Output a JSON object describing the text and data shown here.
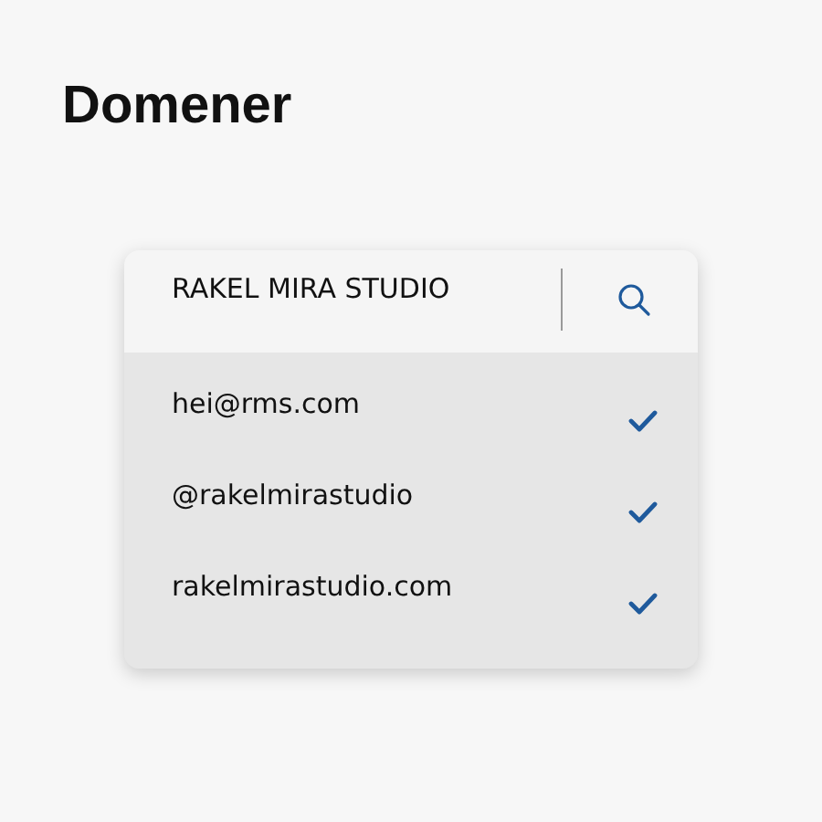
{
  "page": {
    "title": "Domener"
  },
  "card": {
    "header": {
      "title": "RAKEL MIRA STUDIO"
    },
    "items": [
      {
        "label": "hei@rms.com",
        "checked": true
      },
      {
        "label": "@rakelmirastudio",
        "checked": true
      },
      {
        "label": "rakelmirastudio.com",
        "checked": true
      }
    ]
  }
}
